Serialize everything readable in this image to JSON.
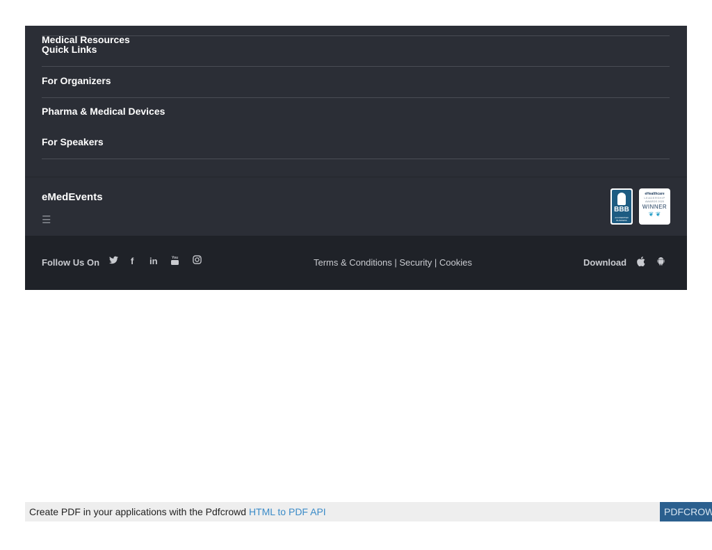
{
  "footer": {
    "links": [
      {
        "label": "Medical Resources"
      },
      {
        "label": "Quick Links"
      },
      {
        "label": "For Organizers"
      },
      {
        "label": "Pharma & Medical Devices"
      },
      {
        "label": "For Speakers"
      }
    ],
    "brand": "eMedEvents",
    "menu_icon": "☰",
    "badges": {
      "bbb": {
        "name": "bbb-accredited-badge",
        "text": "BBB",
        "subtext": "ACCREDITED BUSINESS"
      },
      "ehealthcare": {
        "line1": "eHealthcare",
        "line2": "LEADERSHIP",
        "line3": "AWARDS 2020",
        "line4": "WINNER"
      }
    },
    "bottom": {
      "follow_label": "Follow Us On",
      "social_icons": [
        {
          "name": "twitter-icon",
          "glyph": "🐦"
        },
        {
          "name": "facebook-icon",
          "glyph": "f"
        },
        {
          "name": "linkedin-icon",
          "glyph": "in"
        },
        {
          "name": "youtube-icon",
          "glyph": "▶"
        },
        {
          "name": "instagram-icon",
          "glyph": "◎"
        }
      ],
      "legal": {
        "terms": "Terms & Conditions",
        "sep1": " | ",
        "security": "Security",
        "sep2": " | ",
        "cookies": "Cookies"
      },
      "download_label": "Download",
      "app_icons": [
        {
          "name": "apple-icon",
          "glyph": ""
        },
        {
          "name": "android-icon",
          "glyph": "▲"
        }
      ]
    }
  },
  "pdf_bar": {
    "text": "Create PDF in your applications with the Pdfcrowd ",
    "link": "HTML to PDF API",
    "brand": "PDFCROWD"
  },
  "colors": {
    "footer_bg": "#2b2e36",
    "bottom_bg": "#1f2228",
    "link_color": "#3a8bc8",
    "pdf_brand_bg": "#2b5f8e"
  }
}
